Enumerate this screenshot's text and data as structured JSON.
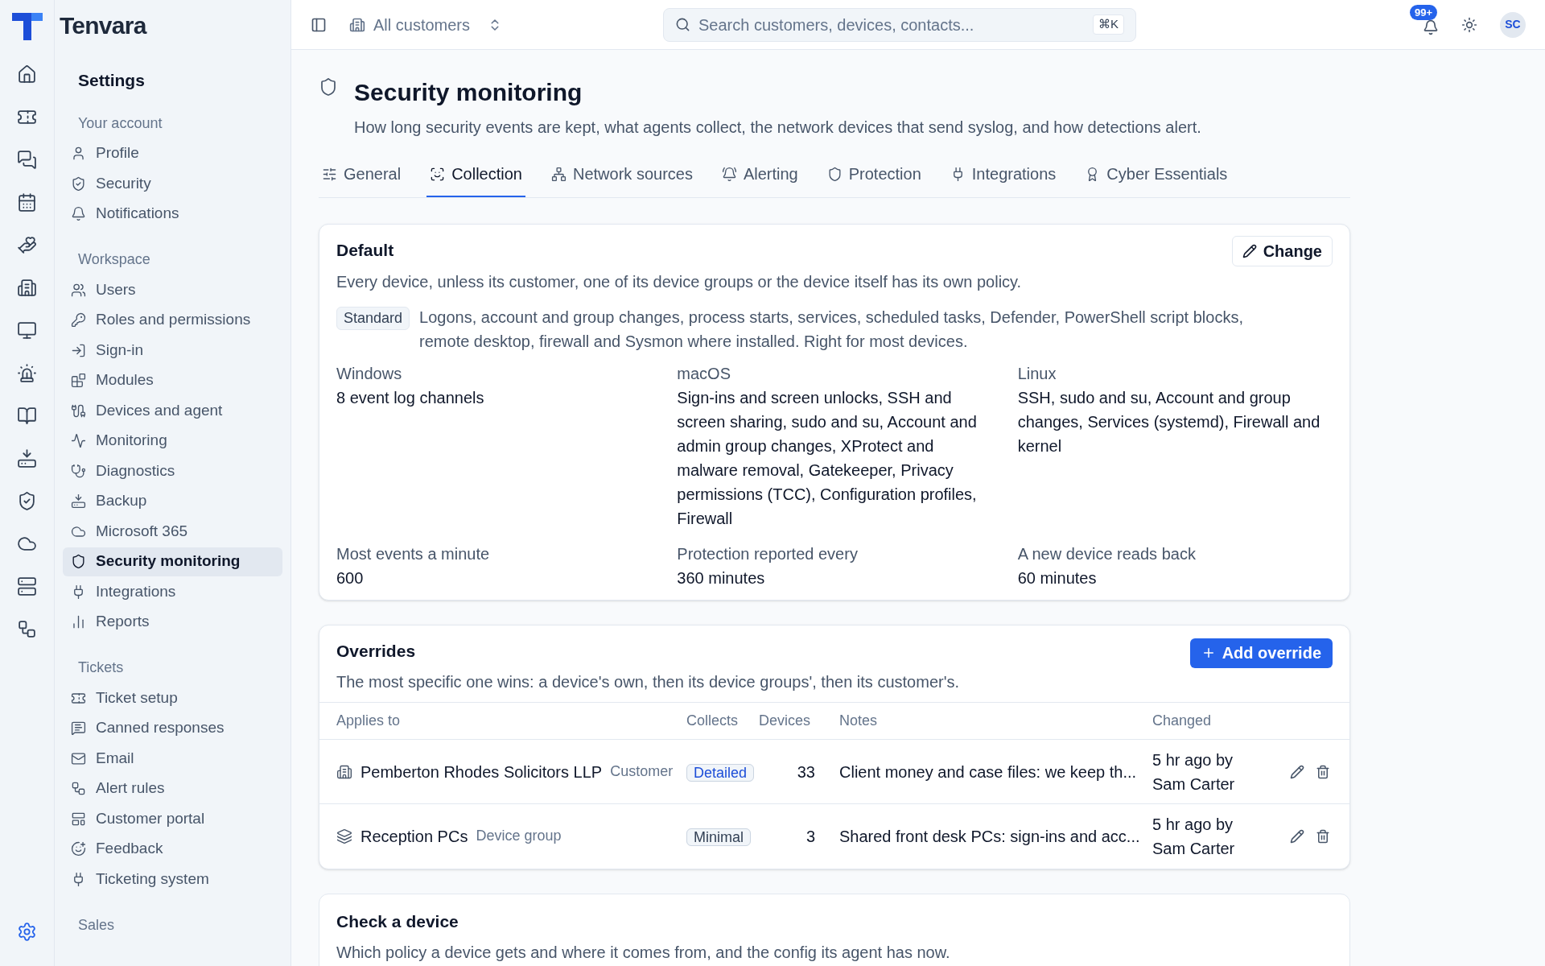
{
  "brand": {
    "name": "Tenvara"
  },
  "rail_items": [
    {
      "selected": false
    },
    {
      "selected": false
    },
    {
      "selected": false
    },
    {
      "selected": false
    },
    {
      "selected": false
    },
    {
      "selected": false
    },
    {
      "selected": false
    },
    {
      "selected": false
    },
    {
      "selected": false
    },
    {
      "selected": false
    },
    {
      "selected": false
    },
    {
      "selected": false
    },
    {
      "selected": false
    },
    {
      "selected": false
    },
    {
      "selected": true
    }
  ],
  "sidebar": {
    "title": "Settings",
    "sections": [
      {
        "heading": "Your account",
        "items": [
          {
            "label": "Profile",
            "selected": false
          },
          {
            "label": "Security",
            "selected": false
          },
          {
            "label": "Notifications",
            "selected": false
          }
        ]
      },
      {
        "heading": "Workspace",
        "items": [
          {
            "label": "Users",
            "selected": false
          },
          {
            "label": "Roles and permissions",
            "selected": false
          },
          {
            "label": "Sign-in",
            "selected": false
          },
          {
            "label": "Modules",
            "selected": false
          },
          {
            "label": "Devices and agent",
            "selected": false
          },
          {
            "label": "Monitoring",
            "selected": false
          },
          {
            "label": "Diagnostics",
            "selected": false
          },
          {
            "label": "Backup",
            "selected": false
          },
          {
            "label": "Microsoft 365",
            "selected": false
          },
          {
            "label": "Security monitoring",
            "selected": true
          },
          {
            "label": "Integrations",
            "selected": false
          },
          {
            "label": "Reports",
            "selected": false
          }
        ]
      },
      {
        "heading": "Tickets",
        "items": [
          {
            "label": "Ticket setup",
            "selected": false
          },
          {
            "label": "Canned responses",
            "selected": false
          },
          {
            "label": "Email",
            "selected": false
          },
          {
            "label": "Alert rules",
            "selected": false
          },
          {
            "label": "Customer portal",
            "selected": false
          },
          {
            "label": "Feedback",
            "selected": false
          },
          {
            "label": "Ticketing system",
            "selected": false
          }
        ]
      },
      {
        "heading": "Sales"
      }
    ]
  },
  "topbar": {
    "customer_picker": "All customers",
    "search": {
      "placeholder": "Search customers, devices, contacts...",
      "shortcut": "⌘K"
    },
    "notifications_badge": "99+",
    "avatar": "SC"
  },
  "page": {
    "title": "Security monitoring",
    "description": "How long security events are kept, what agents collect, the network devices that send syslog, and how detections alert."
  },
  "tabs": [
    {
      "label": "General",
      "selected": false
    },
    {
      "label": "Collection",
      "selected": true
    },
    {
      "label": "Network sources",
      "selected": false
    },
    {
      "label": "Alerting",
      "selected": false
    },
    {
      "label": "Protection",
      "selected": false
    },
    {
      "label": "Integrations",
      "selected": false
    },
    {
      "label": "Cyber Essentials",
      "selected": false
    }
  ],
  "default_policy": {
    "title": "Default",
    "description": "Every device, unless its customer, one of its device groups or the device itself has its own policy.",
    "button": "Change",
    "level_badge": "Standard",
    "level_description": "Logons, account and group changes, process starts, services, scheduled tasks, Defender, PowerShell script blocks, remote desktop, firewall and Sysmon where installed. Right for most devices.",
    "platforms": [
      {
        "name": "Windows",
        "value": "8 event log channels"
      },
      {
        "name": "macOS",
        "value": "Sign-ins and screen unlocks, SSH and screen sharing, sudo and su, Account and admin group changes, XProtect and malware removal, Gatekeeper, Privacy permissions (TCC), Configuration profiles, Firewall"
      },
      {
        "name": "Linux",
        "value": "SSH, sudo and su, Account and group changes, Services (systemd), Firewall and kernel"
      }
    ],
    "stats": [
      {
        "name": "Most events a minute",
        "value": "600"
      },
      {
        "name": "Protection reported every",
        "value": "360 minutes"
      },
      {
        "name": "A new device reads back",
        "value": "60 minutes"
      }
    ]
  },
  "overrides": {
    "title": "Overrides",
    "description": "The most specific one wins: a device's own, then its device groups', then its customer's.",
    "button": "Add override",
    "columns": [
      "Applies to",
      "Collects",
      "Devices",
      "Notes",
      "Changed"
    ],
    "rows": [
      {
        "kind": "customer",
        "name": "Pemberton Rhodes Solicitors LLP",
        "type": "Customer",
        "collects": {
          "label": "Detailed",
          "color": "#1d4ed8"
        },
        "devices": "33",
        "notes": "Client money and case files: we keep th...",
        "changed": "5 hr ago by Sam Carter"
      },
      {
        "kind": "group",
        "name": "Reception PCs",
        "type": "Device group",
        "collects": {
          "label": "Minimal",
          "color": "#334155"
        },
        "devices": "3",
        "notes": "Shared front desk PCs: sign-ins and acc...",
        "changed": "5 hr ago by Sam Carter"
      }
    ]
  },
  "check_device": {
    "title": "Check a device",
    "description": "Which policy a device gets and where it comes from, and the config its agent has now."
  }
}
